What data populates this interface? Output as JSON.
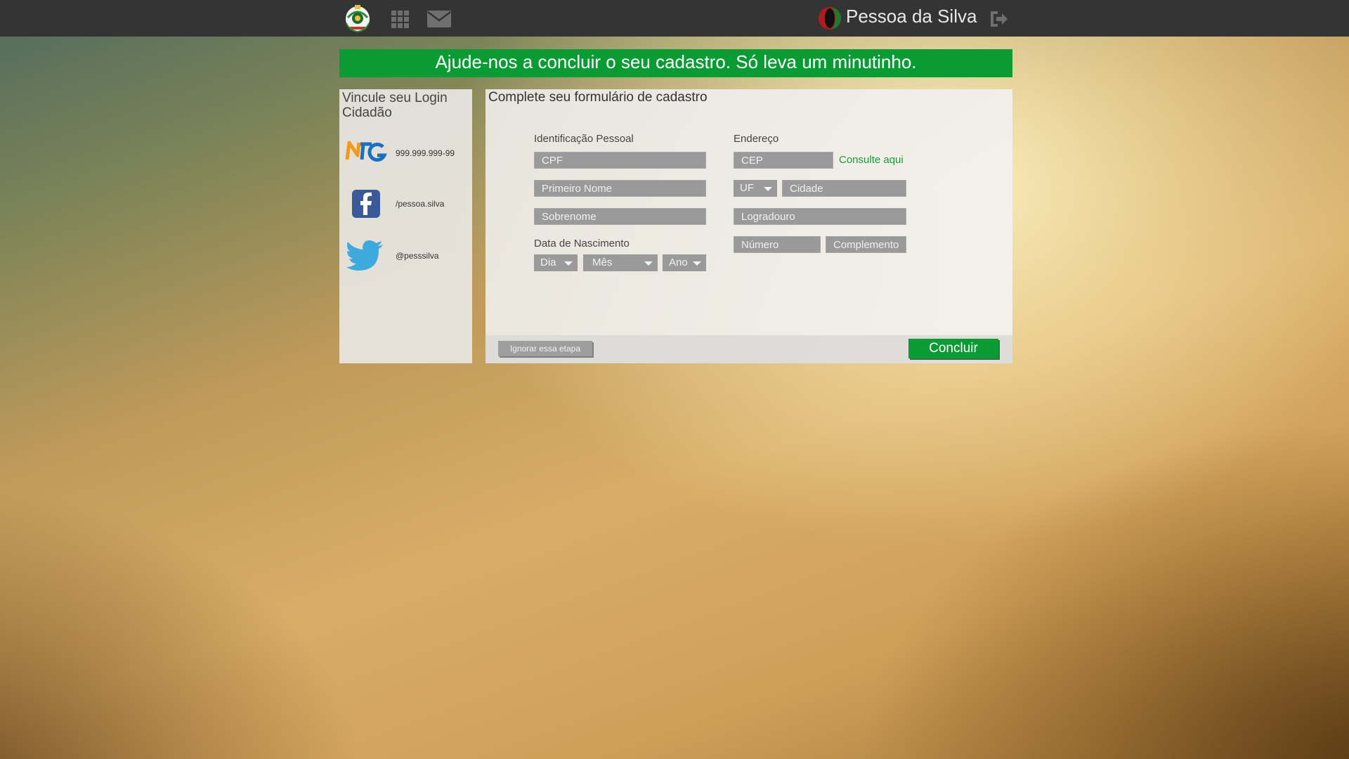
{
  "header": {
    "user_name": "Pessoa da Silva",
    "icons": [
      "state-coat-of-arms-logo",
      "apps-grid-icon",
      "mail-icon",
      "user-avatar",
      "logout-icon"
    ]
  },
  "banner": {
    "message": "Ajude-nos a concluir o seu cadastro. Só leva um minutinho."
  },
  "link_panel": {
    "title": "Vincule seu Login Cidadão",
    "accounts": [
      {
        "service": "nfg",
        "label": "999.999.999-99"
      },
      {
        "service": "facebook",
        "label": "/pessoa.silva"
      },
      {
        "service": "twitter",
        "label": "@pesssilva"
      }
    ]
  },
  "form": {
    "title": "Complete seu formulário de cadastro",
    "personal": {
      "section_label": "Identificação Pessoal",
      "cpf_placeholder": "CPF",
      "first_name_placeholder": "Primeiro Nome",
      "last_name_placeholder": "Sobrenome"
    },
    "birth": {
      "section_label": "Data de Nascimento",
      "day": "Dia",
      "month": "Mês",
      "year": "Ano"
    },
    "address": {
      "section_label": "Endereço",
      "cep_placeholder": "CEP",
      "consult_link": "Consulte aqui",
      "uf": "UF",
      "city_placeholder": "Cidade",
      "street_placeholder": "Logradouro",
      "number_placeholder": "Número",
      "complement_placeholder": "Complemento"
    },
    "skip_label": "Ignorar essa etapa",
    "submit_label": "Concluir"
  },
  "colors": {
    "brand_green": "#0a9b35",
    "topbar": "#343434",
    "field_gray": "#9a9a9a",
    "link_green": "#1a9a3a"
  }
}
